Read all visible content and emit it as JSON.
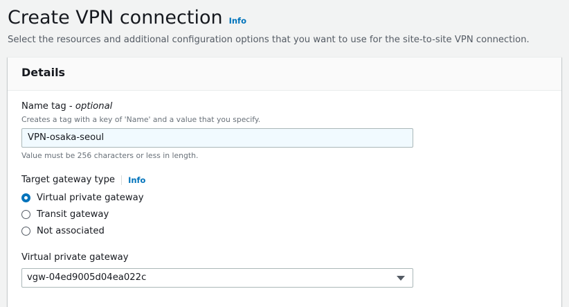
{
  "page": {
    "title": "Create VPN connection",
    "info_label": "Info",
    "description": "Select the resources and additional configuration options that you want to use for the site-to-site VPN connection."
  },
  "details": {
    "heading": "Details",
    "name_tag": {
      "label": "Name tag -",
      "optional": "optional",
      "description": "Creates a tag with a key of 'Name' and a value that you specify.",
      "value": "VPN-osaka-seoul",
      "constraint": "Value must be 256 characters or less in length."
    },
    "target_gateway_type": {
      "label": "Target gateway type",
      "info_label": "Info",
      "options": [
        {
          "label": "Virtual private gateway",
          "selected": true
        },
        {
          "label": "Transit gateway",
          "selected": false
        },
        {
          "label": "Not associated",
          "selected": false
        }
      ]
    },
    "virtual_private_gateway": {
      "label": "Virtual private gateway",
      "selected_value": "vgw-04ed9005d04ea022c"
    }
  },
  "colors": {
    "link": "#0073bb",
    "radio_selected": "#0073bb",
    "input_bg_focused": "#f1faff"
  }
}
